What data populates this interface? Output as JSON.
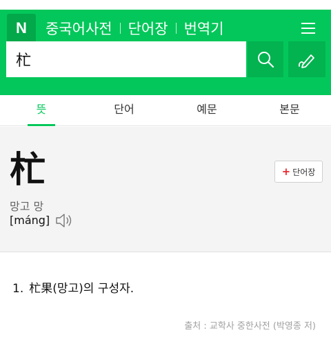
{
  "header": {
    "logo": "N",
    "nav": [
      "중국어사전",
      "단어장",
      "번역기"
    ]
  },
  "search": {
    "value": "杧"
  },
  "tabs": [
    "뜻",
    "단어",
    "예문",
    "본문"
  ],
  "active_tab": 0,
  "entry": {
    "headword": "杧",
    "pronunciation_kr": "망고 망",
    "pinyin": "[máng]",
    "add_button": "단어장"
  },
  "meaning": {
    "number": "1.",
    "text": "杧果(망고)의 구성자."
  },
  "source": "출처 : 교학사 중한사전 (박영종 저)",
  "colors": {
    "brand": "#03c75a",
    "add_plus": "#e8262b"
  },
  "icons": [
    "menu-icon",
    "search-icon",
    "pen-icon",
    "speaker-icon",
    "plus-icon"
  ]
}
